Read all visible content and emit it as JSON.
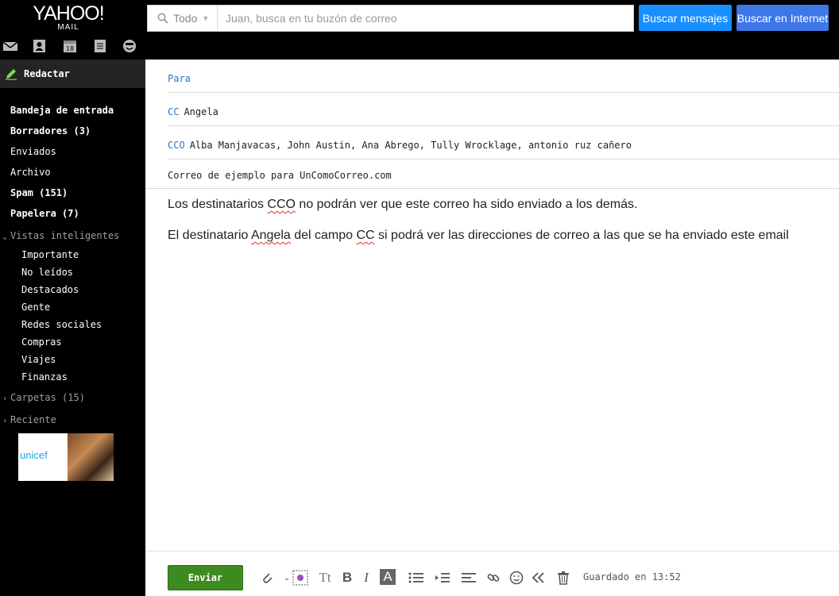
{
  "header": {
    "logo_main": "YAHOO!",
    "logo_sub": "MAIL",
    "search_scope": "Todo",
    "search_placeholder": "Juan, busca en tu buzón de correo",
    "btn_search_mail": "Buscar mensajes",
    "btn_search_web": "Buscar en Internet"
  },
  "nav_icons": [
    "mail-icon",
    "contacts-icon",
    "calendar-icon",
    "notepad-icon",
    "messenger-icon"
  ],
  "calendar_day": "18",
  "sidebar": {
    "compose": "Redactar",
    "folders": [
      {
        "label": "Bandeja de entrada"
      },
      {
        "label": "Borradores (3)"
      },
      {
        "label": "Enviados"
      },
      {
        "label": "Archivo"
      },
      {
        "label": "Spam (151)"
      },
      {
        "label": "Papelera (7)"
      }
    ],
    "smart_title": "Vistas inteligentes",
    "smart_views": [
      "Importante",
      "No leídos",
      "Destacados",
      "Gente",
      "Redes sociales",
      "Compras",
      "Viajes",
      "Finanzas"
    ],
    "folders_section": "Carpetas (15)",
    "recent_section": "Reciente",
    "ad_brand": "unicef"
  },
  "compose": {
    "to_label": "Para",
    "to_value": "",
    "cc_label": "CC",
    "cc_value": "Angela",
    "bcc_label": "CCO",
    "bcc_value": "Alba Manjavacas, John Austin, Ana Abrego, Tully Wrocklage, antonio ruz cañero",
    "subject": "Correo de ejemplo para UnComoCorreo.com",
    "body": {
      "l1_a": "Los destinatarios ",
      "l1_b": "CCO",
      "l1_c": " no podrán ver que este correo ha sido enviado a los demás.",
      "l2_a": "El destinatario ",
      "l2_b": "Angela",
      "l2_c": " del campo ",
      "l2_d": "CC",
      "l2_e": " si podrá ver las direcciones de correo a las que se ha enviado este email"
    },
    "send": "Enviar",
    "saved": "Guardado en 13:52",
    "tool_text_size": "Tt",
    "tool_bold": "B",
    "tool_italic": "I",
    "tool_color": "A"
  }
}
